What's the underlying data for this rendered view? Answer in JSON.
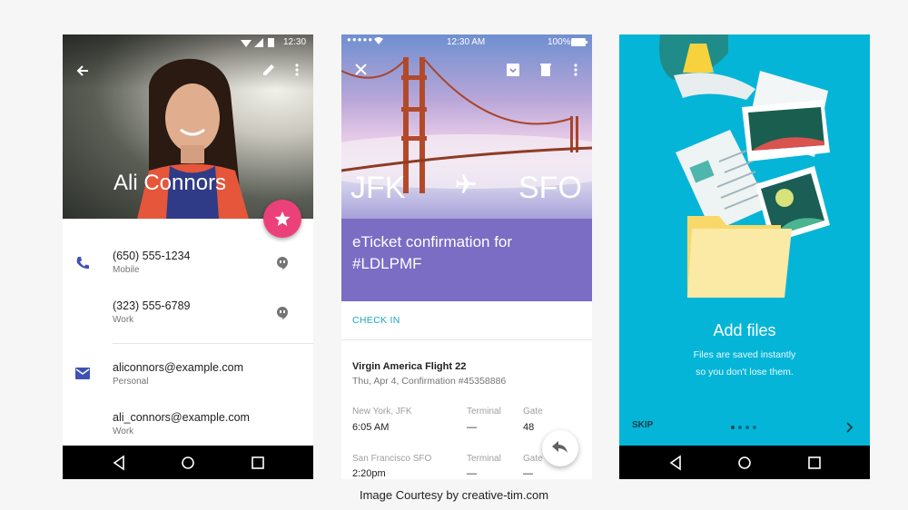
{
  "phone1": {
    "status_time": "12:30",
    "contact_name": "Ali Connors",
    "phones": [
      {
        "number": "(650) 555-1234",
        "type": "Mobile"
      },
      {
        "number": "(323) 555-6789",
        "type": "Work"
      }
    ],
    "emails": [
      {
        "address": "aliconnors@example.com",
        "type": "Personal"
      },
      {
        "address": "ali_connors@example.com",
        "type": "Work"
      }
    ]
  },
  "phone2": {
    "status_time": "12:30 AM",
    "battery": "100%",
    "origin": "JFK",
    "destination": "SFO",
    "title_line1": "eTicket confirmation for",
    "title_line2": "#LDLPMF",
    "check_in": "CHECK IN",
    "flight_name": "Virgin America Flight 22",
    "flight_detail": "Thu, Apr 4, Confirmation #45358886",
    "legs": [
      {
        "place": "New York, JFK",
        "time": "6:05 AM",
        "terminal_label": "Terminal",
        "terminal": "—",
        "gate_label": "Gate",
        "gate": "48"
      },
      {
        "place": "San Francisco SFO",
        "time": "2:20pm",
        "terminal_label": "Terminal",
        "terminal": "—",
        "gate_label": "Gate",
        "gate": "—"
      }
    ]
  },
  "phone3": {
    "heading": "Add files",
    "subtitle_line1": "Files are saved instantly",
    "subtitle_line2": "so you don't lose them.",
    "skip": "SKIP"
  },
  "caption": "Image Courtesy by creative-tim.com",
  "colors": {
    "fab": "#ec407a",
    "purple": "#7b6cc4",
    "accent": "#1aa7c4",
    "onboarding_bg": "#05b5d8"
  }
}
